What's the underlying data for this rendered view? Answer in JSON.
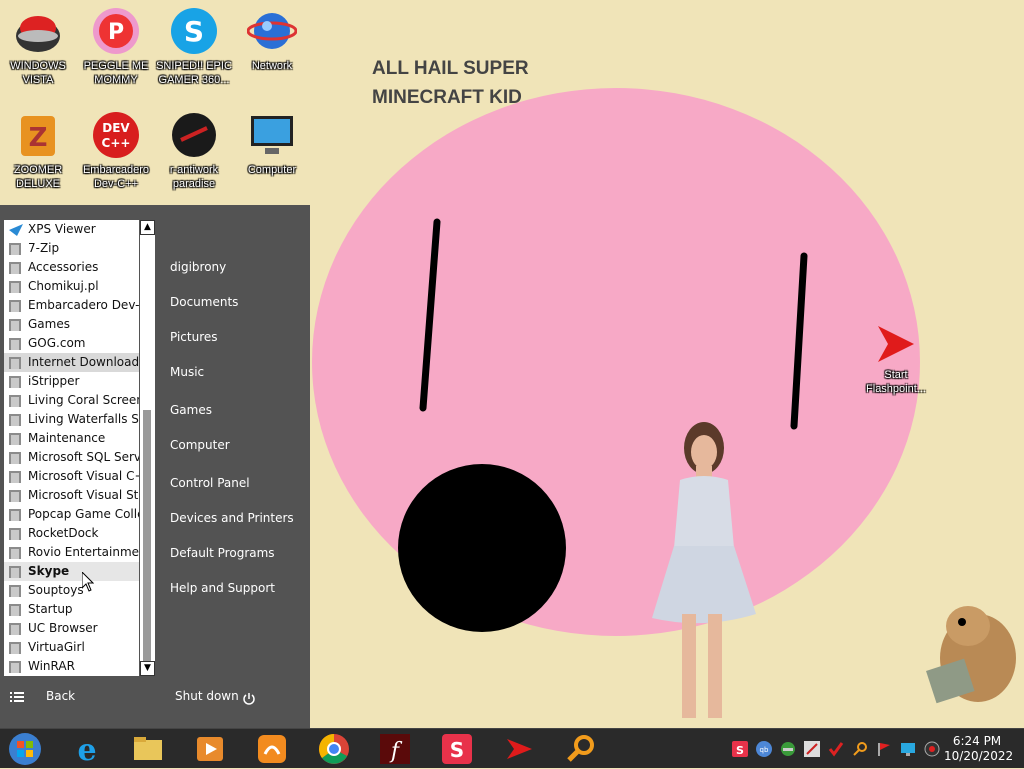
{
  "wallpaper": {
    "title": "ALL HAIL SUPER\nMINECRAFT KID"
  },
  "desktop_icons": [
    {
      "label": "WINDOWS\nVISTA",
      "icon": "pokeball-icon"
    },
    {
      "label": "PEGGLE ME\nMOMMY",
      "icon": "peggle-icon"
    },
    {
      "label": "SNIPED!! EPIC\nGAMER 360...",
      "icon": "skype-icon"
    },
    {
      "label": "Network",
      "icon": "network-globe-icon"
    },
    {
      "label": "ZOOMER\nDELUXE",
      "icon": "zoomer-icon"
    },
    {
      "label": "Embarcadero\nDev-C++",
      "icon": "devcpp-icon"
    },
    {
      "label": "r-antiwork\nparadise",
      "icon": "antiwork-icon"
    },
    {
      "label": "Computer",
      "icon": "computer-icon"
    },
    {
      "label": "Start\nFlashpoint...",
      "icon": "flashpoint-icon"
    }
  ],
  "start_menu": {
    "programs": [
      "XPS Viewer",
      "7-Zip",
      "Accessories",
      "Chomikuj.pl",
      "Embarcadero Dev-C++",
      "Games",
      "GOG.com",
      "Internet Download Manager",
      "iStripper",
      "Living Coral Screensaver",
      "Living Waterfalls Screensaver",
      "Maintenance",
      "Microsoft SQL Server",
      "Microsoft Visual C++",
      "Microsoft Visual Studio",
      "Popcap Game Collection",
      "RocketDock",
      "Rovio Entertainment",
      "Skype",
      "Souptoys",
      "Startup",
      "UC Browser",
      "VirtuaGirl",
      "WinRAR"
    ],
    "selected": "Skype",
    "right_links": [
      "digibrony",
      "Documents",
      "Pictures",
      "Music",
      "Games",
      "Computer",
      "Control Panel",
      "Devices and Printers",
      "Default Programs",
      "Help and Support"
    ],
    "back_label": "Back",
    "shutdown_label": "Shut down"
  },
  "taskbar": {
    "pinned": [
      "start-orb-icon",
      "internet-explorer-icon",
      "file-explorer-icon",
      "media-player-icon",
      "uc-browser-icon",
      "chrome-icon",
      "flash-icon",
      "skype-sniped-icon",
      "flashpoint-icon",
      "search-magnifier-icon"
    ],
    "tray_icons": [
      "skype-tray-icon",
      "qb-icon",
      "network-tray-icon",
      "antiwork-tray-icon",
      "checkmark-icon",
      "search-tray-icon",
      "flag-icon",
      "monitor-icon",
      "record-icon"
    ],
    "time": "6:24 PM",
    "date": "10/20/2022"
  }
}
